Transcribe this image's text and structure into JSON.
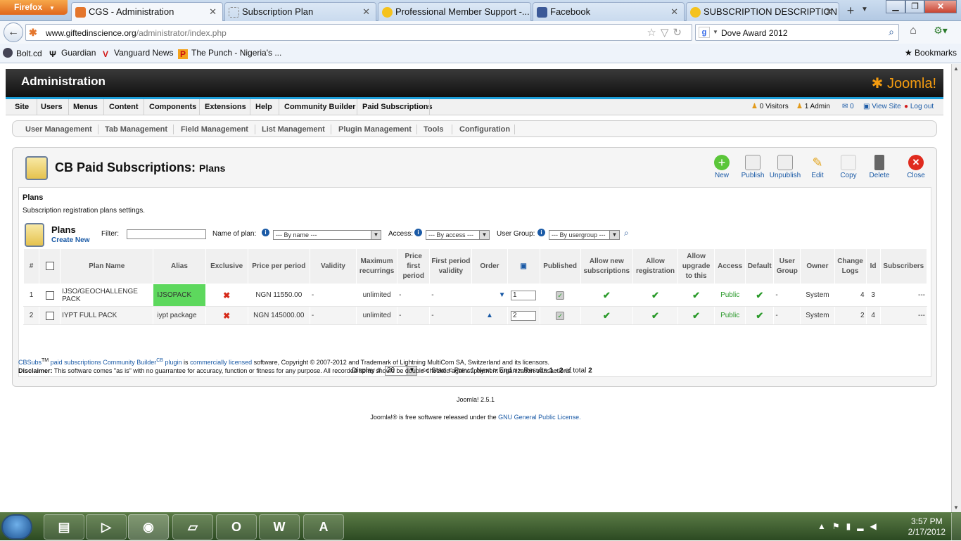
{
  "browser": {
    "app_button": "Firefox",
    "tabs": [
      {
        "label": "CGS - Administration",
        "active": true
      },
      {
        "label": "Subscription Plan",
        "active": false
      },
      {
        "label": "Professional Member Support -...",
        "active": false
      },
      {
        "label": "Facebook",
        "active": false
      },
      {
        "label": "SUBSCRIPTION DESCRIPTION ...",
        "active": false
      }
    ],
    "url_host": "www.giftedinscience.org",
    "url_path": "/administrator/index.php",
    "search_value": "Dove Award 2012",
    "bookmarks": [
      "Bolt.cd",
      "Guardian",
      "Vanguard News",
      "The Punch - Nigeria's ..."
    ],
    "bookmarks_menu": "Bookmarks"
  },
  "header": {
    "title": "Administration",
    "logo_text": "Joomla!"
  },
  "menu": {
    "items": [
      "Site",
      "Users",
      "Menus",
      "Content",
      "Components",
      "Extensions",
      "Help",
      "Community Builder",
      "Paid Subscriptions"
    ],
    "visitors": "0 Visitors",
    "admins": "1 Admin",
    "messages": "0",
    "view_site": "View Site",
    "logout": "Log out"
  },
  "submenu": [
    "User Management",
    "Tab Management",
    "Field Management",
    "List Management",
    "Plugin Management",
    "Tools",
    "Configuration"
  ],
  "page": {
    "title": "CB Paid Subscriptions:",
    "subtitle": "Plans",
    "toolbar": [
      "New",
      "Publish",
      "Unpublish",
      "Edit",
      "Copy",
      "Delete",
      "Close"
    ],
    "section_title": "Plans",
    "section_desc": "Subscription registration plans settings.",
    "list_title": "Plans",
    "create_new": "Create New",
    "filter_label": "Filter:",
    "name_label": "Name of plan:",
    "name_select": "--- By name ---",
    "access_label": "Access:",
    "access_select": "--- By access ---",
    "group_label": "User Group:",
    "group_select": "--- By usergroup ---"
  },
  "table": {
    "headers": [
      "#",
      "",
      "Plan Name",
      "Alias",
      "Exclusive",
      "Price per period",
      "Validity",
      "Maximum recurrings",
      "Price first period",
      "First period validity",
      "Order",
      "",
      "Published",
      "Allow new subscriptions",
      "Allow registration",
      "Allow upgrade to this",
      "Access",
      "Default",
      "User Group",
      "Owner",
      "Change Logs",
      "Id",
      "Subscribers"
    ],
    "rows": [
      {
        "num": "1",
        "name": "IJSO/GEOCHALLENGE PACK",
        "alias": "IJSOPACK",
        "price": "NGN 11550.00",
        "validity": "-",
        "max_rec": "unlimited",
        "pfirst": "-",
        "fvalid": "-",
        "order": "1",
        "access": "Public",
        "group": "-",
        "owner": "System",
        "logs": "4",
        "id": "3",
        "subs": "---"
      },
      {
        "num": "2",
        "name": "IYPT FULL PACK",
        "alias": "iypt package",
        "price": "NGN 145000.00",
        "validity": "-",
        "max_rec": "unlimited",
        "pfirst": "-",
        "fvalid": "-",
        "order": "2",
        "access": "Public",
        "group": "-",
        "owner": "System",
        "logs": "2",
        "id": "4",
        "subs": "---"
      }
    ]
  },
  "pager": {
    "display_label": "Display #",
    "display_value": "20",
    "nav": "<< Start < Prev 1 Next > End >>",
    "results_prefix": "Results",
    "results_range": "1 - 2",
    "results_mid": "of total",
    "results_total": "2"
  },
  "legal": {
    "brand": "CBSubs",
    "tm": "TM",
    "link1": "paid subscriptions",
    "link2": "Community Builder",
    "cb": "CB",
    "link3": "plugin",
    "is": "is",
    "link4": "commercially licensed",
    "rest": "software, Copyright © 2007-2012 and Trademark of Lightning MultiCom SA, Switzerland and its licensors.",
    "disclaimer_label": "Disclaimer:",
    "disclaimer": "This software comes \"as is\" with no guarrantee for accuracy, function or fitness for any purpose. All recorded items should be double-checked against payment organization transactions."
  },
  "footer": {
    "version": "Joomla! 2.5.1",
    "lic_link": "Joomla!®",
    "lic_text": "is free software released under the",
    "lic_link2": "GNU General Public License."
  },
  "taskbar": {
    "time": "3:57 PM",
    "date": "2/17/2012"
  }
}
